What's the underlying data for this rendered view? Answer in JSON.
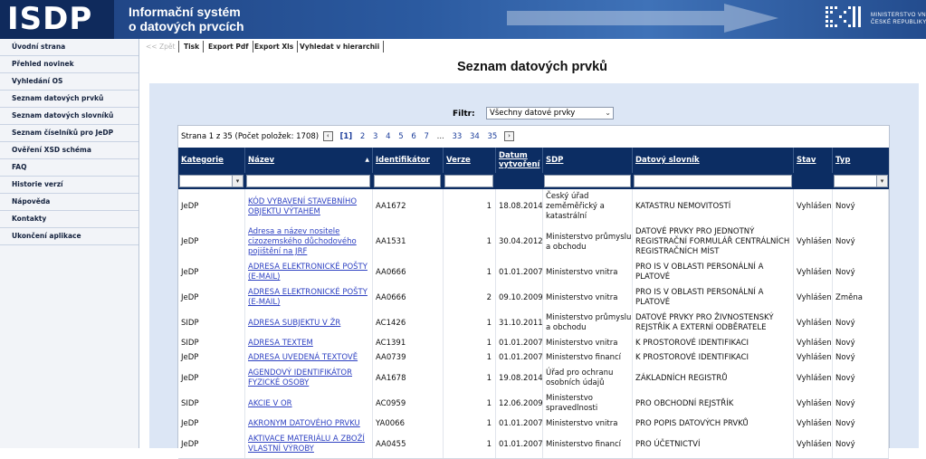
{
  "header": {
    "logo": "ISDP",
    "title_line1": "Informační systém",
    "title_line2": "o datových prvcích",
    "ministry_line1": "MINISTERSTVO VNITRA",
    "ministry_line2": "ČESKÉ REPUBLIKY"
  },
  "sidebar": {
    "items": [
      "Úvodní strana",
      "Přehled novinek",
      "Vyhledání OS",
      "Seznam datových prvků",
      "Seznam datových slovníků",
      "Seznam číselníků pro JeDP",
      "Ověření XSD schéma",
      "FAQ",
      "Historie verzí",
      "Nápověda",
      "Kontakty",
      "Ukončení aplikace"
    ]
  },
  "toolbar": {
    "back": "<< Zpět",
    "print": "Tisk",
    "export_pdf": "Export Pdf",
    "export_xls": "Export Xls",
    "search_hierarchy": "Vyhledat v hierarchii"
  },
  "page_title": "Seznam datových prvků",
  "filter": {
    "label": "Filtr:",
    "selected": "Všechny datové prvky"
  },
  "pager": {
    "info": "Strana 1 z 35 (Počet položek: 1708)",
    "current": "[1]",
    "pages": [
      "2",
      "3",
      "4",
      "5",
      "6",
      "7",
      "...",
      "33",
      "34",
      "35"
    ]
  },
  "table": {
    "columns": [
      "Kategorie",
      "Název",
      "Identifikátor",
      "Verze",
      "Datum vytvoření",
      "SDP",
      "Datový slovník",
      "Stav",
      "Typ"
    ],
    "rows": [
      [
        "JeDP",
        "KÓD VYBAVENÍ STAVEBNÍHO OBJEKTU VÝTAHEM",
        "AA1672",
        "1",
        "18.08.2014",
        "Český úřad zeměměřický a katastrální",
        "KATASTRU NEMOVITOSTÍ",
        "Vyhlášen",
        "Nový"
      ],
      [
        "JeDP",
        "Adresa a název nositele cizozemského důchodového pojištění na JRF",
        "AA1531",
        "1",
        "30.04.2012",
        "Ministerstvo průmyslu a obchodu",
        "DATOVÉ PRVKY PRO JEDNOTNÝ REGISTRAČNÍ FORMULÁŘ CENTRÁLNÍCH REGISTRAČNÍCH MÍST",
        "Vyhlášen",
        "Nový"
      ],
      [
        "JeDP",
        "ADRESA ELEKTRONICKÉ POŠTY (E-MAIL)",
        "AA0666",
        "1",
        "01.01.2007",
        "Ministerstvo vnitra",
        "PRO IS V OBLASTI PERSONÁLNÍ A PLATOVÉ",
        "Vyhlášen",
        "Nový"
      ],
      [
        "JeDP",
        "ADRESA ELEKTRONICKÉ POŠTY (E-MAIL)",
        "AA0666",
        "2",
        "09.10.2009",
        "Ministerstvo vnitra",
        "PRO IS V OBLASTI PERSONÁLNÍ A PLATOVÉ",
        "Vyhlášen",
        "Změna"
      ],
      [
        "SIDP",
        "ADRESA SUBJEKTU V ŽR",
        "AC1426",
        "1",
        "31.10.2011",
        "Ministerstvo průmyslu a obchodu",
        "DATOVÉ PRVKY PRO ŽIVNOSTENSKÝ REJSTŘÍK A EXTERNÍ ODBĚRATELE",
        "Vyhlášen",
        "Nový"
      ],
      [
        "SIDP",
        "ADRESA TEXTEM",
        "AC1391",
        "1",
        "01.01.2007",
        "Ministerstvo vnitra",
        "K PROSTOROVÉ IDENTIFIKACI",
        "Vyhlášen",
        "Nový"
      ],
      [
        "JeDP",
        "ADRESA UVEDENÁ TEXTOVĚ",
        "AA0739",
        "1",
        "01.01.2007",
        "Ministerstvo financí",
        "K PROSTOROVÉ IDENTIFIKACI",
        "Vyhlášen",
        "Nový"
      ],
      [
        "JeDP",
        "AGENDOVÝ IDENTIFIKÁTOR FYZICKÉ OSOBY",
        "AA1678",
        "1",
        "19.08.2014",
        "Úřad pro ochranu osobních údajů",
        "ZÁKLADNÍCH REGISTRŮ",
        "Vyhlášen",
        "Nový"
      ],
      [
        "SIDP",
        "AKCIE V OR",
        "AC0959",
        "1",
        "12.06.2009",
        "Ministerstvo spravedlnosti",
        "PRO OBCHODNÍ REJSTŘÍK",
        "Vyhlášen",
        "Nový"
      ],
      [
        "JeDP",
        "AKRONYM DATOVÉHO PRVKU",
        "YA0066",
        "1",
        "01.01.2007",
        "Ministerstvo vnitra",
        "PRO POPIS DATOVÝCH PRVKŮ",
        "Vyhlášen",
        "Nový"
      ],
      [
        "JeDP",
        "AKTIVACE MATERIÁLU A ZBOŽÍ VLASTNÍ VÝROBY",
        "AA0455",
        "1",
        "01.01.2007",
        "Ministerstvo financí",
        "PRO ÚČETNICTVÍ",
        "Vyhlášen",
        "Nový"
      ]
    ]
  },
  "colors": {
    "header_bg": "#1d3f7d",
    "grid_head": "#0c2d63",
    "panel": "#dce6f5",
    "link": "#2e41c2"
  }
}
